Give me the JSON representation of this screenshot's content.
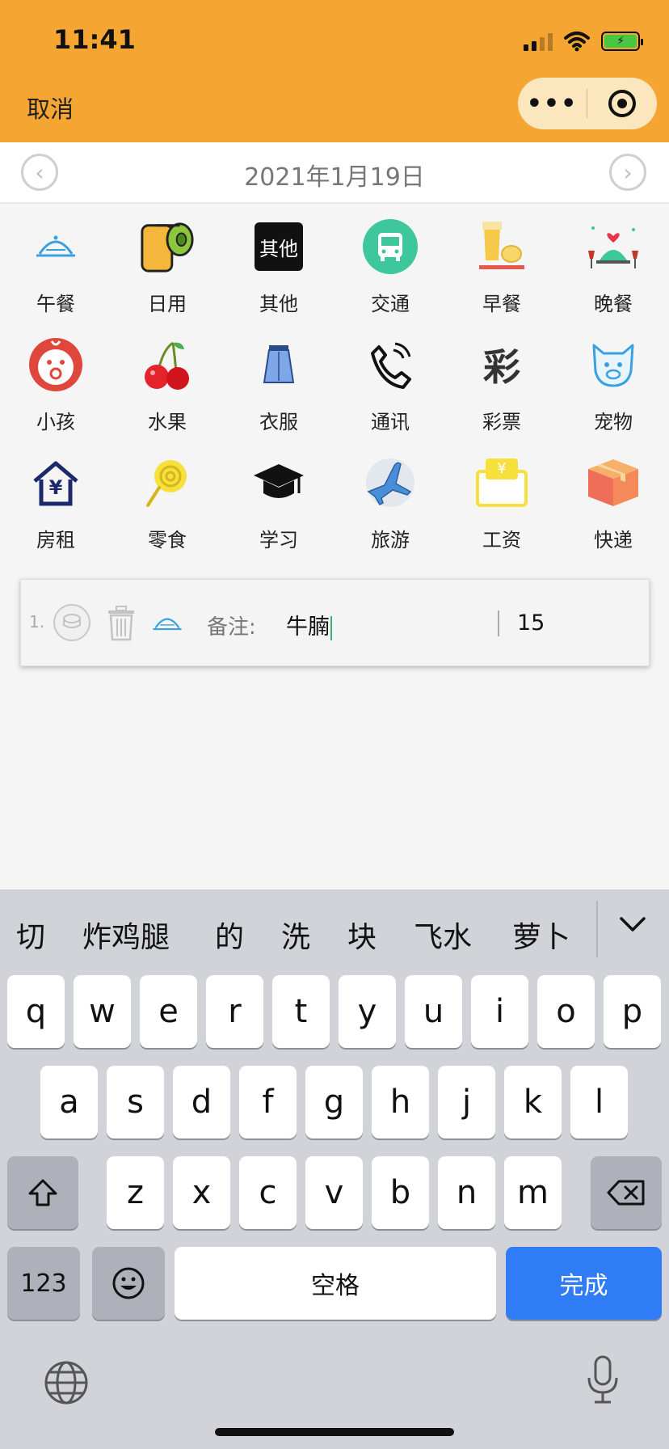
{
  "status": {
    "time": "11:41"
  },
  "nav": {
    "cancel": "取消",
    "more": "•••",
    "close_icon": "target-icon"
  },
  "date": {
    "text": "2021年1月19日",
    "prev_icon": "chevron-left-icon",
    "next_icon": "chevron-right-icon"
  },
  "categories": [
    {
      "label": "午餐",
      "icon": "cloche-icon"
    },
    {
      "label": "日用",
      "icon": "toilet-paper-icon"
    },
    {
      "label": "其他",
      "icon": "other-icon",
      "icon_text": "其他"
    },
    {
      "label": "交通",
      "icon": "bus-icon"
    },
    {
      "label": "早餐",
      "icon": "breakfast-icon"
    },
    {
      "label": "晚餐",
      "icon": "dinner-icon"
    },
    {
      "label": "小孩",
      "icon": "baby-icon"
    },
    {
      "label": "水果",
      "icon": "cherry-icon"
    },
    {
      "label": "衣服",
      "icon": "skirt-icon"
    },
    {
      "label": "通讯",
      "icon": "phone-icon"
    },
    {
      "label": "彩票",
      "icon": "lottery-icon",
      "icon_text": "彩"
    },
    {
      "label": "宠物",
      "icon": "pet-icon"
    },
    {
      "label": "房租",
      "icon": "house-icon",
      "icon_text": "¥"
    },
    {
      "label": "零食",
      "icon": "lollipop-icon"
    },
    {
      "label": "学习",
      "icon": "graduation-cap-icon"
    },
    {
      "label": "旅游",
      "icon": "airplane-icon"
    },
    {
      "label": "工资",
      "icon": "wallet-icon",
      "icon_text": "¥"
    },
    {
      "label": "快递",
      "icon": "package-icon"
    }
  ],
  "entry": {
    "index": "1.",
    "note_label": "备注:",
    "note_value": "牛腩",
    "amount": "15"
  },
  "keyboard": {
    "candidates": [
      "切",
      "炸鸡腿",
      "的",
      "洗",
      "块",
      "飞水",
      "萝卜"
    ],
    "row1": [
      "q",
      "w",
      "e",
      "r",
      "t",
      "y",
      "u",
      "i",
      "o",
      "p"
    ],
    "row2": [
      "a",
      "s",
      "d",
      "f",
      "g",
      "h",
      "j",
      "k",
      "l"
    ],
    "row3": [
      "z",
      "x",
      "c",
      "v",
      "b",
      "n",
      "m"
    ],
    "numbers_key": "123",
    "space_key": "空格",
    "done_key": "完成"
  },
  "colors": {
    "header": "#f5a532",
    "done_key": "#2f7cf6"
  }
}
